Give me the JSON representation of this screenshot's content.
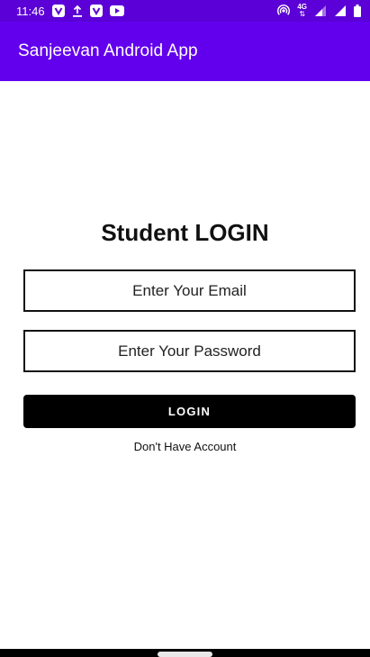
{
  "status_bar": {
    "time": "11:46",
    "left_icons": [
      "v-notification-icon",
      "upload-icon",
      "v-notification-icon",
      "media-icon"
    ],
    "right_icons": [
      "hotspot-icon",
      "4g-data-icon",
      "signal-icon",
      "signal-full-icon",
      "battery-icon"
    ],
    "network_label": "4G"
  },
  "app_bar": {
    "title": "Sanjeevan Android App"
  },
  "login": {
    "title": "Student LOGIN",
    "email_placeholder": "Enter Your Email",
    "password_placeholder": "Enter Your Password",
    "login_button": "LOGIN",
    "no_account_link": "Don't Have Account"
  },
  "colors": {
    "status_bar": "#5b00d6",
    "app_bar": "#6200ee",
    "button": "#000000",
    "nav_bar": "#000000"
  }
}
